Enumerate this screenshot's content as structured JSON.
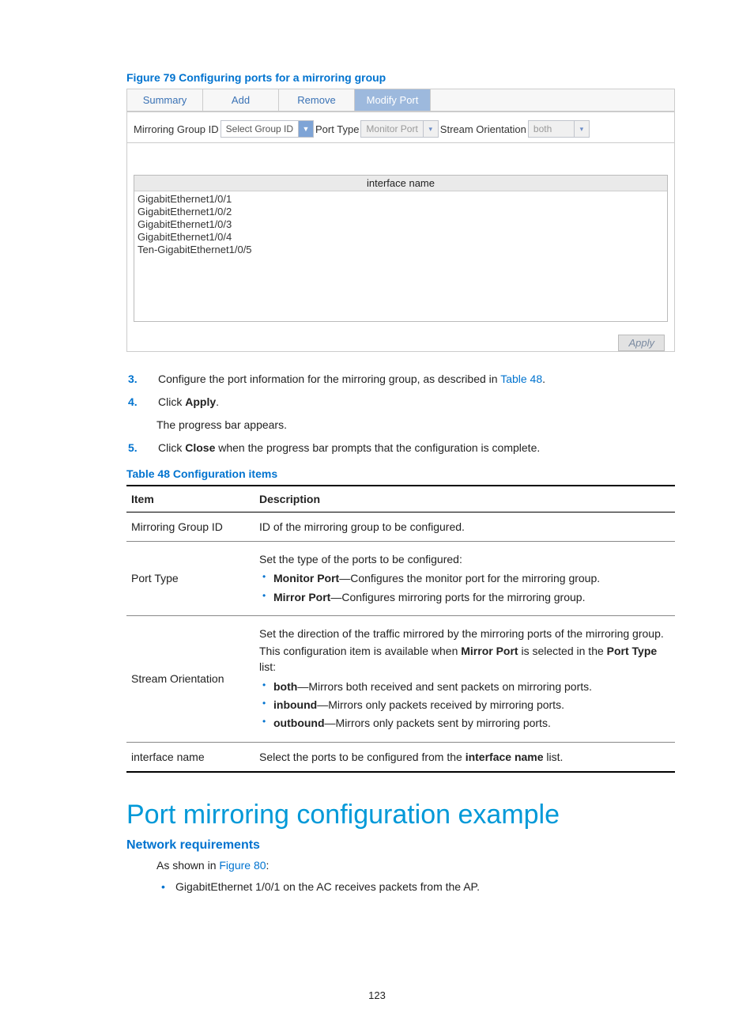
{
  "figure": {
    "caption": "Figure 79 Configuring ports for a mirroring group",
    "tabs": [
      "Summary",
      "Add",
      "Remove",
      "Modify Port"
    ],
    "activeTabIndex": 3,
    "labels": {
      "mirroringGroupId": "Mirroring Group ID",
      "portType": "Port Type",
      "streamOrientation": "Stream Orientation"
    },
    "dropdowns": {
      "groupId": "Select Group ID",
      "portType": "Monitor Port",
      "orientation": "both"
    },
    "interfaceHeader": "interface name",
    "interfaces": [
      "GigabitEthernet1/0/1",
      "GigabitEthernet1/0/2",
      "GigabitEthernet1/0/3",
      "GigabitEthernet1/0/4",
      "Ten-GigabitEthernet1/0/5"
    ],
    "applyLabel": "Apply"
  },
  "steps": {
    "s3_num": "3.",
    "s3_a": "Configure the port information for the mirroring group, as described in ",
    "s3_link": "Table 48",
    "s3_b": ".",
    "s4_num": "4.",
    "s4_a": "Click ",
    "s4_bold": "Apply",
    "s4_b": ".",
    "s4_sub": "The progress bar appears.",
    "s5_num": "5.",
    "s5_a": "Click ",
    "s5_bold": "Close",
    "s5_b": " when the progress bar prompts that the configuration is complete."
  },
  "table": {
    "caption": "Table 48 Configuration items",
    "headers": {
      "item": "Item",
      "desc": "Description"
    },
    "row1": {
      "item": "Mirroring Group ID",
      "desc": "ID of the mirroring group to be configured."
    },
    "row2": {
      "item": "Port Type",
      "intro": "Set the type of the ports to be configured:",
      "b1_bold": "Monitor Port",
      "b1_rest": "—Configures the monitor port for the mirroring group.",
      "b2_bold": "Mirror Port",
      "b2_rest": "—Configures mirroring ports for the mirroring group."
    },
    "row3": {
      "item": "Stream Orientation",
      "p1": "Set the direction of the traffic mirrored by the mirroring ports of the mirroring group.",
      "p2_a": "This configuration item is available when ",
      "p2_bold1": "Mirror Port",
      "p2_mid": " is selected in the ",
      "p2_bold2": "Port Type",
      "p2_end": " list:",
      "b1_bold": "both",
      "b1_rest": "—Mirrors both received and sent packets on mirroring ports.",
      "b2_bold": "inbound",
      "b2_rest": "—Mirrors only packets received by mirroring ports.",
      "b3_bold": "outbound",
      "b3_rest": "—Mirrors only packets sent by mirroring ports."
    },
    "row4": {
      "item": "interface name",
      "desc_a": "Select the ports to be configured from the ",
      "desc_bold": "interface name",
      "desc_b": " list."
    }
  },
  "heading": "Port mirroring configuration example",
  "subheading": "Network requirements",
  "body": {
    "intro_a": "As shown in ",
    "intro_link": "Figure 80",
    "intro_b": ":",
    "bullet1": "GigabitEthernet 1/0/1 on the AC receives packets from the AP."
  },
  "pageNumber": "123"
}
